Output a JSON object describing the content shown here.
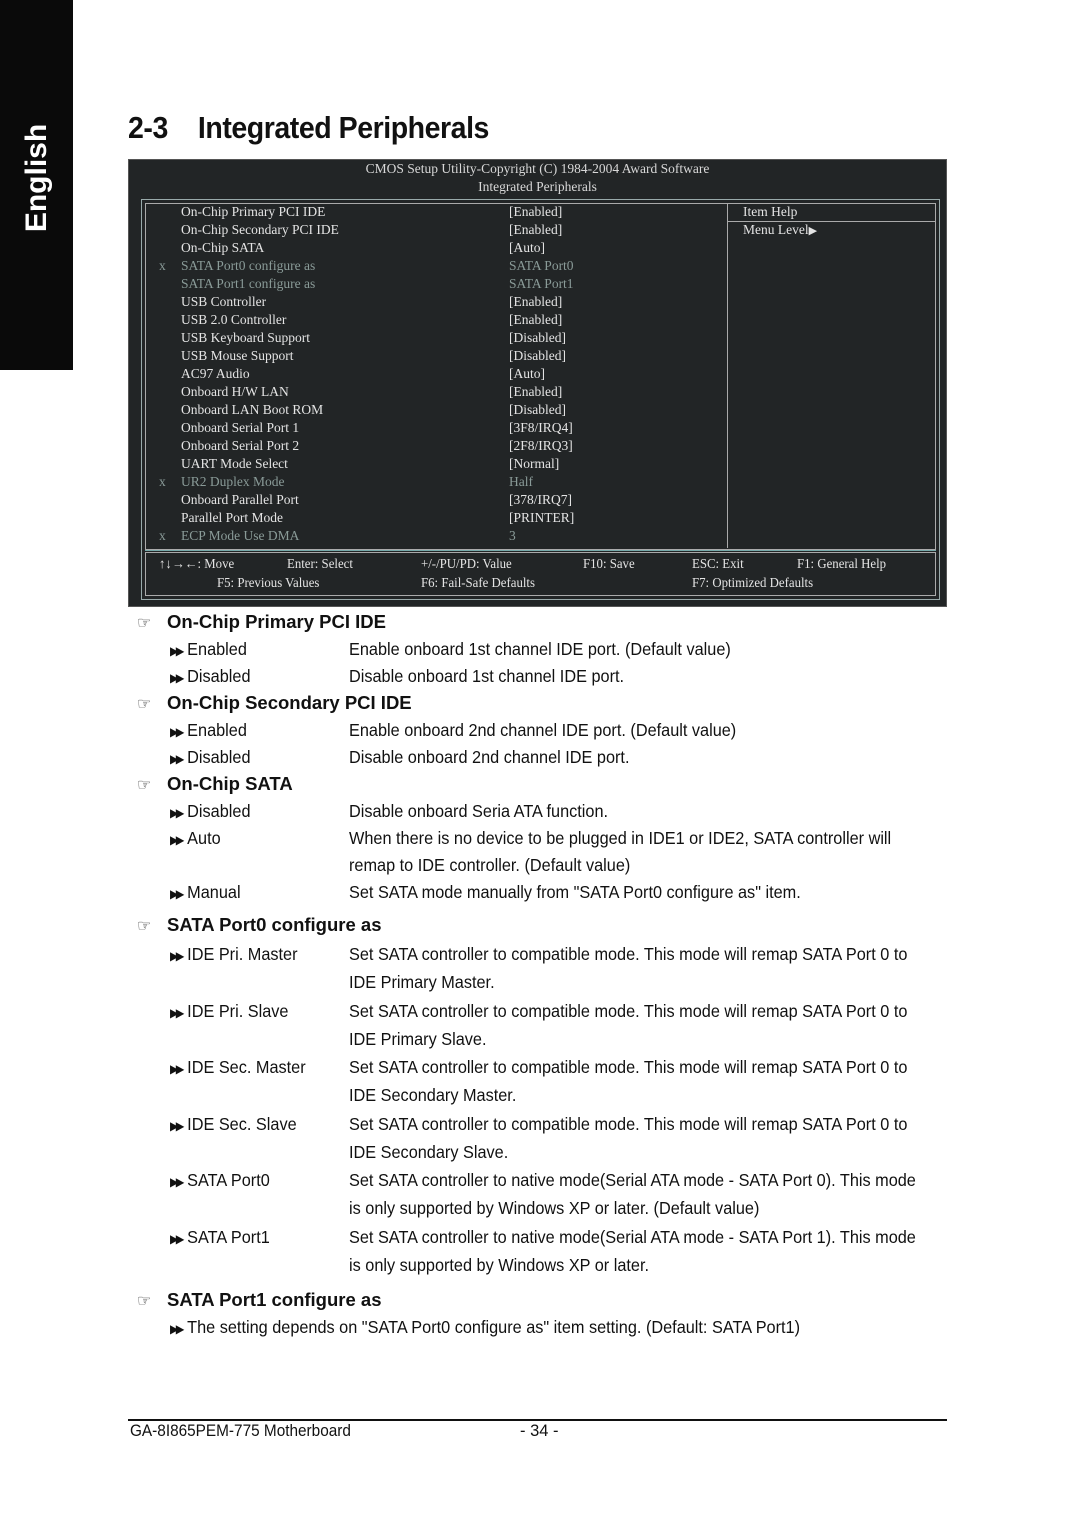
{
  "sidebar": {
    "language_tab": "English"
  },
  "header": {
    "section_number": "2-3",
    "title": "Integrated Peripherals"
  },
  "bios": {
    "copyright": "CMOS Setup Utility-Copyright (C) 1984-2004 Award Software",
    "screen_title": "Integrated Peripherals",
    "items": [
      {
        "mark": "",
        "label": "On-Chip Primary PCI IDE",
        "value": "[Enabled]",
        "disabled": false
      },
      {
        "mark": "",
        "label": "On-Chip Secondary PCI IDE",
        "value": "[Enabled]",
        "disabled": false
      },
      {
        "mark": "",
        "label": "On-Chip SATA",
        "value": "[Auto]",
        "disabled": false
      },
      {
        "mark": "x",
        "label": "SATA Port0 configure as",
        "value": "SATA Port0",
        "disabled": true
      },
      {
        "mark": "",
        "label": "SATA Port1 configure as",
        "value": "SATA Port1",
        "disabled": true
      },
      {
        "mark": "",
        "label": "USB Controller",
        "value": "[Enabled]",
        "disabled": false
      },
      {
        "mark": "",
        "label": "USB 2.0 Controller",
        "value": "[Enabled]",
        "disabled": false
      },
      {
        "mark": "",
        "label": "USB Keyboard Support",
        "value": "[Disabled]",
        "disabled": false
      },
      {
        "mark": "",
        "label": "USB Mouse Support",
        "value": "[Disabled]",
        "disabled": false
      },
      {
        "mark": "",
        "label": "AC97 Audio",
        "value": "[Auto]",
        "disabled": false
      },
      {
        "mark": "",
        "label": "Onboard H/W LAN",
        "value": "[Enabled]",
        "disabled": false
      },
      {
        "mark": "",
        "label": "Onboard LAN Boot ROM",
        "value": "[Disabled]",
        "disabled": false
      },
      {
        "mark": "",
        "label": "Onboard Serial Port 1",
        "value": "[3F8/IRQ4]",
        "disabled": false
      },
      {
        "mark": "",
        "label": "Onboard Serial Port 2",
        "value": "[2F8/IRQ3]",
        "disabled": false
      },
      {
        "mark": "",
        "label": "UART Mode Select",
        "value": "[Normal]",
        "disabled": false
      },
      {
        "mark": "x",
        "label": "UR2 Duplex Mode",
        "value": "Half",
        "disabled": true
      },
      {
        "mark": "",
        "label": "Onboard Parallel Port",
        "value": "[378/IRQ7]",
        "disabled": false
      },
      {
        "mark": "",
        "label": "Parallel Port Mode",
        "value": "[PRINTER]",
        "disabled": false
      },
      {
        "mark": "x",
        "label": "ECP Mode Use DMA",
        "value": "3",
        "disabled": true
      }
    ],
    "help_title": "Item Help",
    "help_menu_level": "Menu Level",
    "help_menu_icon": "triangle-right-icon",
    "keys_row1": [
      {
        "key": "↑↓→←:",
        "action": "Move"
      },
      {
        "key": "Enter:",
        "action": "Select"
      },
      {
        "key": "+/-/PU/PD:",
        "action": "Value"
      },
      {
        "key": "F10:",
        "action": "Save"
      },
      {
        "key": "ESC:",
        "action": "Exit"
      },
      {
        "key": "F1:",
        "action": "General Help"
      }
    ],
    "keys_row2": [
      {
        "key": "F5:",
        "action": "Previous Values"
      },
      {
        "key": "F6:",
        "action": "Fail-Safe Defaults"
      },
      {
        "key": "F7:",
        "action": "Optimized Defaults"
      }
    ]
  },
  "sections": [
    {
      "title": "On-Chip Primary PCI IDE",
      "options": [
        {
          "name": "Enabled",
          "desc": [
            "Enable onboard 1st channel IDE port. (Default value)"
          ]
        },
        {
          "name": "Disabled",
          "desc": [
            "Disable onboard 1st channel IDE port."
          ]
        }
      ]
    },
    {
      "title": "On-Chip Secondary PCI IDE",
      "options": [
        {
          "name": "Enabled",
          "desc": [
            "Enable onboard 2nd channel IDE port. (Default value)"
          ]
        },
        {
          "name": "Disabled",
          "desc": [
            "Disable onboard 2nd channel IDE port."
          ]
        }
      ]
    },
    {
      "title": "On-Chip SATA",
      "options": [
        {
          "name": "Disabled",
          "desc": [
            "Disable onboard Seria ATA function."
          ]
        },
        {
          "name": "Auto",
          "desc": [
            "When there is no device to be plugged in IDE1 or IDE2, SATA controller will",
            "remap to IDE controller. (Default value)"
          ]
        },
        {
          "name": "Manual",
          "desc": [
            "Set SATA mode manually from \"SATA Port0 configure as\" item."
          ]
        }
      ]
    },
    {
      "title": "SATA Port0 configure as",
      "options": [
        {
          "name": "IDE Pri. Master",
          "desc": [
            "Set SATA controller to compatible mode. This mode will remap SATA Port 0 to",
            "IDE Primary Master."
          ]
        },
        {
          "name": "IDE Pri. Slave",
          "desc": [
            "Set SATA controller to compatible mode. This mode will remap SATA Port 0 to",
            "IDE Primary Slave."
          ]
        },
        {
          "name": "IDE Sec. Master",
          "desc": [
            "Set SATA controller to compatible mode. This mode will remap SATA Port 0 to",
            "IDE Secondary Master."
          ]
        },
        {
          "name": "IDE Sec. Slave",
          "desc": [
            "Set SATA controller to compatible mode. This mode will remap SATA Port 0 to",
            "IDE Secondary Slave."
          ]
        },
        {
          "name": "SATA Port0",
          "desc": [
            "Set SATA controller to native mode(Serial ATA mode - SATA Port 0). This mode",
            "is only supported by Windows XP or later. (Default value)"
          ]
        },
        {
          "name": "SATA Port1",
          "desc": [
            "Set SATA controller to native mode(Serial ATA mode - SATA Port 1). This mode",
            "is only supported by Windows XP or later."
          ]
        }
      ]
    },
    {
      "title": "SATA Port1 configure as",
      "note": "The setting depends on \"SATA Port0 configure as\" item setting. (Default: SATA Port1)"
    }
  ],
  "footer": {
    "model": "GA-8I865PEM-775 Motherboard",
    "page": "- 34 -"
  }
}
